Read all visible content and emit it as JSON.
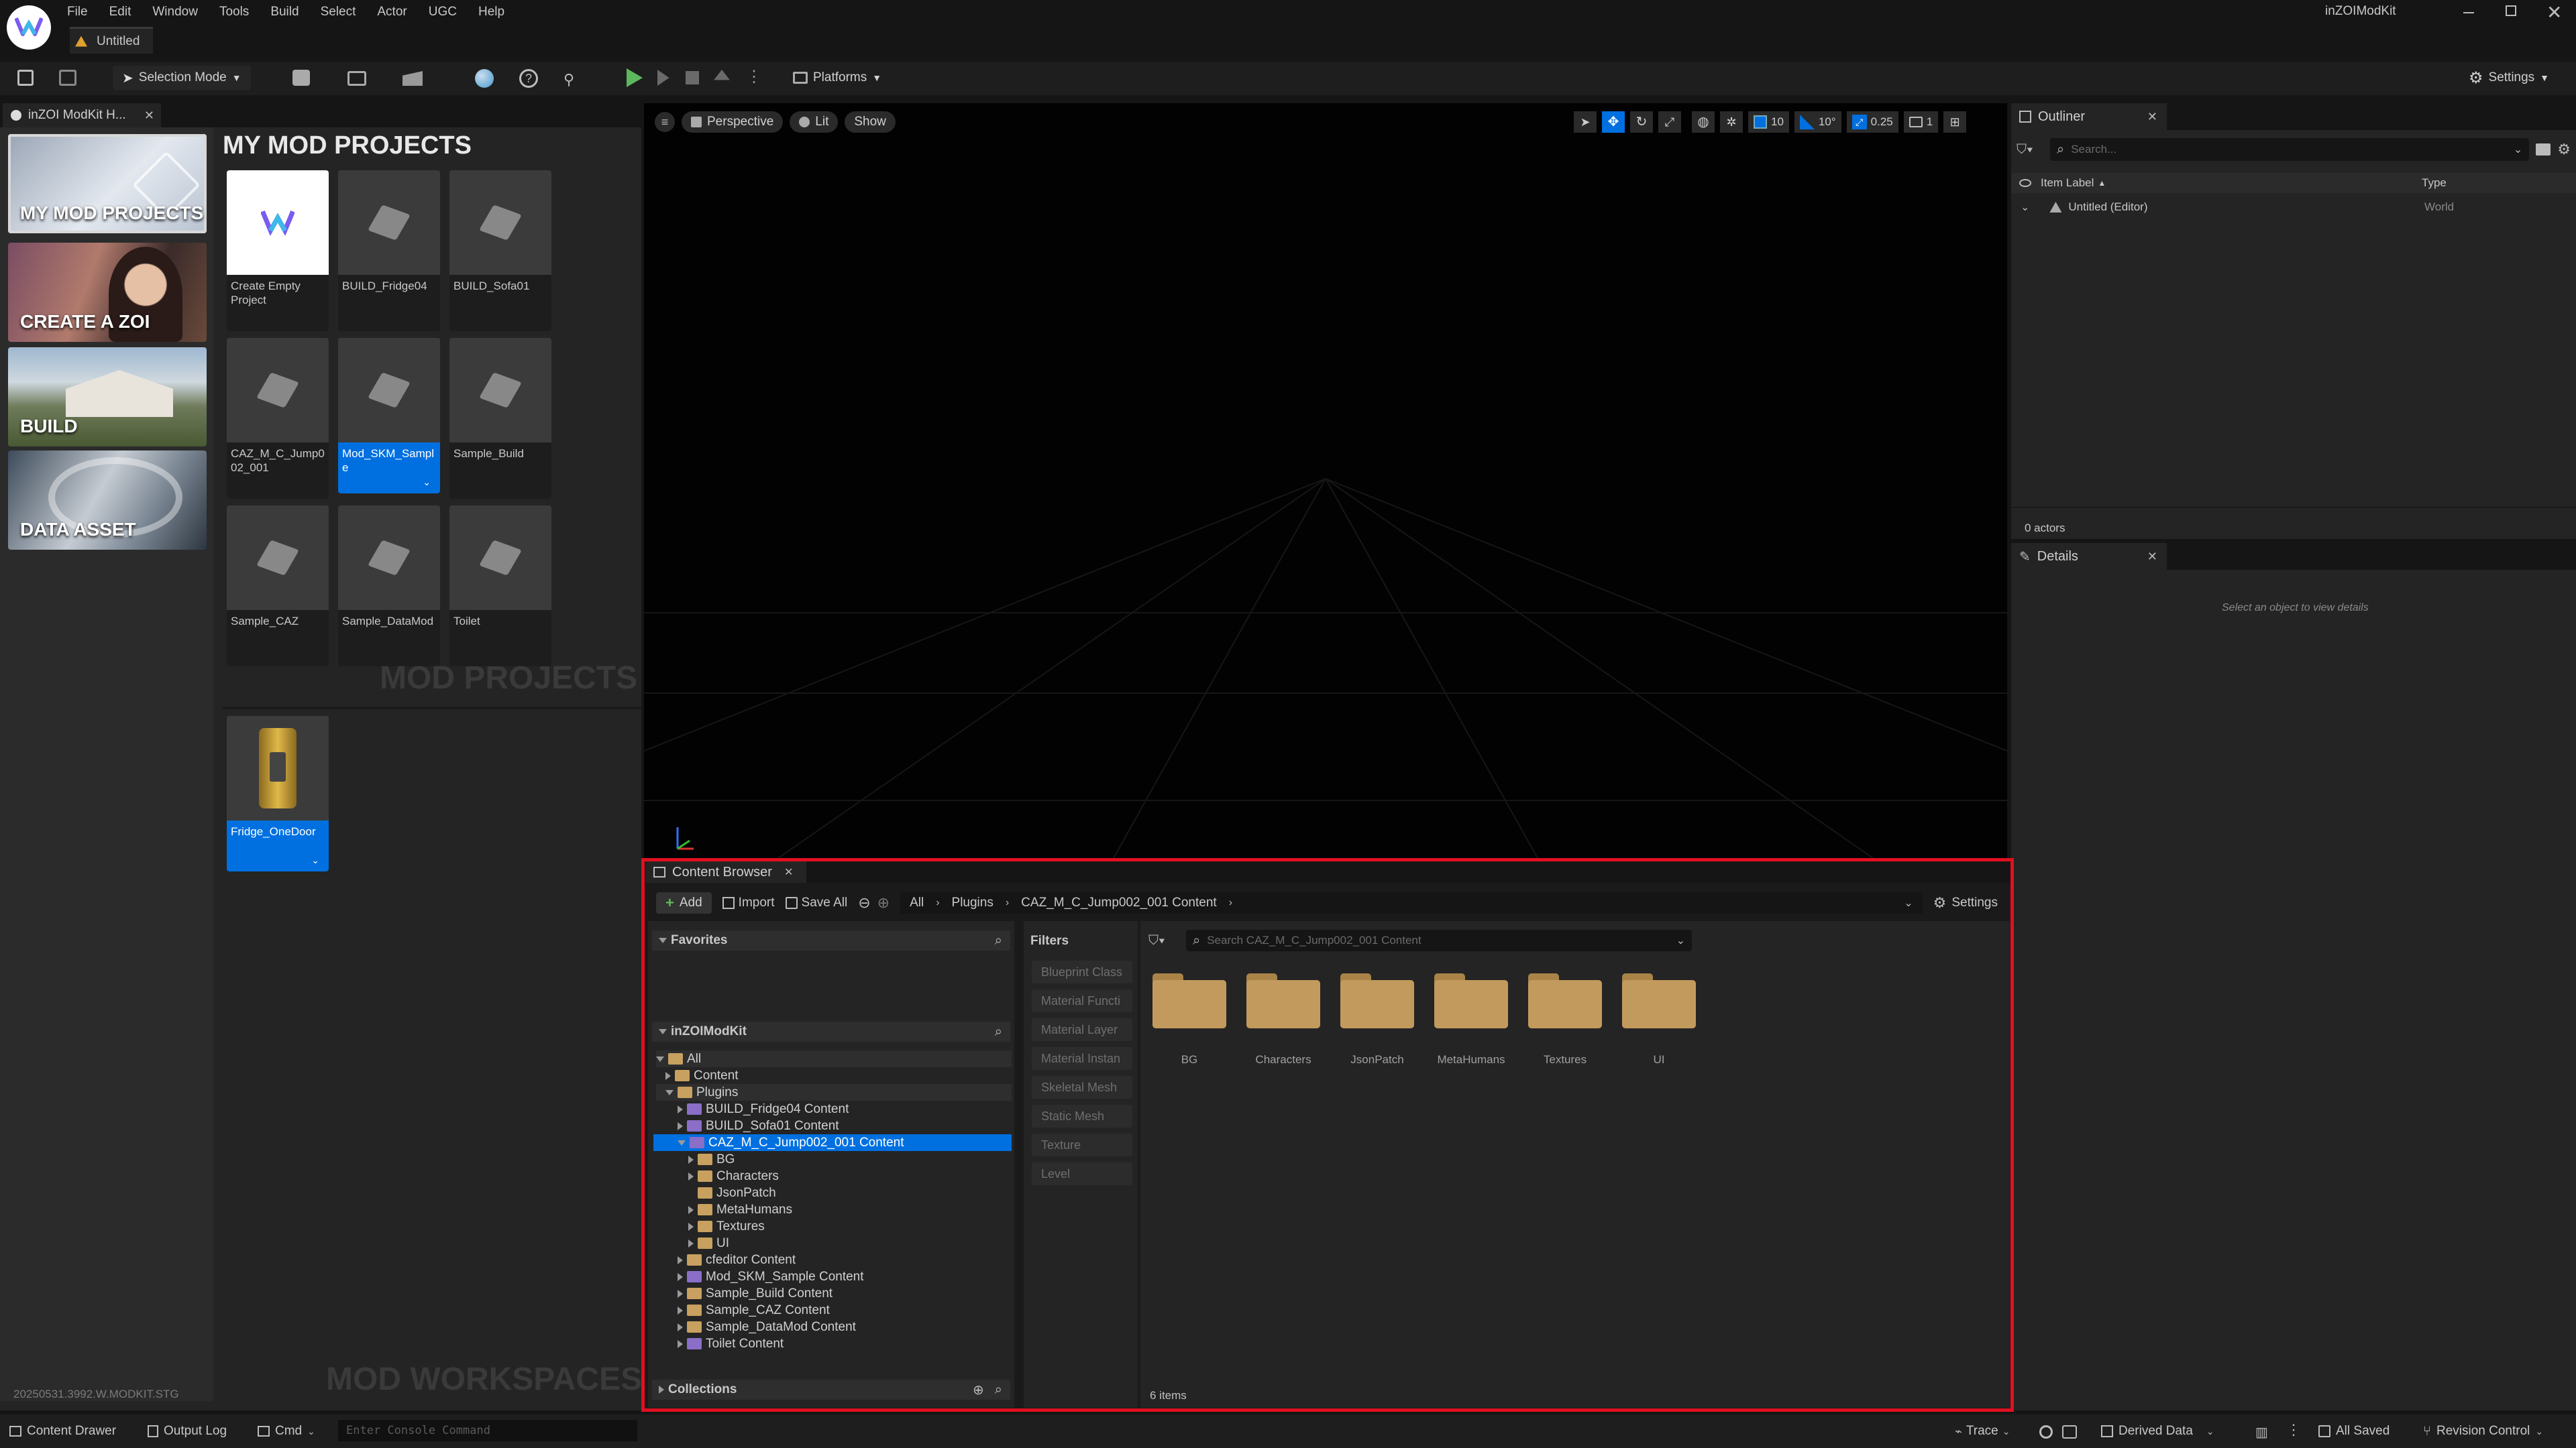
{
  "app": {
    "title": "inZOIModKit",
    "doc_tab": "Untitled",
    "menu": [
      "File",
      "Edit",
      "Window",
      "Tools",
      "Build",
      "Select",
      "Actor",
      "UGC",
      "Help"
    ]
  },
  "toolbar": {
    "selection_mode": "Selection Mode",
    "platforms": "Platforms",
    "settings": "Settings"
  },
  "hub": {
    "tab": "inZOI ModKit H...",
    "title": "MY MOD PROJECTS",
    "categories": [
      "MY MOD PROJECTS",
      "CREATE A ZOI",
      "BUILD",
      "DATA ASSET"
    ],
    "projects": [
      "Create Empty Project",
      "BUILD_Fridge04",
      "BUILD_Sofa01",
      "CAZ_M_C_Jump002_001",
      "Mod_SKM_Sample",
      "Sample_Build",
      "Sample_CAZ",
      "Sample_DataMod",
      "Toilet"
    ],
    "section_projects": "MOD PROJECTS",
    "workspaces": [
      "Fridge_OneDoor"
    ],
    "section_workspaces": "MOD WORKSPACES",
    "version": "20250531.3992.W.MODKIT.STG"
  },
  "viewport": {
    "perspective": "Perspective",
    "lit": "Lit",
    "show": "Show",
    "grid": "10",
    "angle": "10°",
    "scale": "0.25",
    "camera": "1"
  },
  "outliner": {
    "tab": "Outliner",
    "search_placeholder": "Search...",
    "col_label": "Item Label",
    "col_type": "Type",
    "row_label": "Untitled (Editor)",
    "row_type": "World",
    "count": "0 actors"
  },
  "details": {
    "tab": "Details",
    "empty": "Select an object to view details"
  },
  "content_browser": {
    "tab": "Content Browser",
    "add": "Add",
    "import": "Import",
    "save_all": "Save All",
    "path": [
      "All",
      "Plugins",
      "CAZ_M_C_Jump002_001 Content"
    ],
    "settings": "Settings",
    "favorites": "Favorites",
    "root": "inZOIModKit",
    "tree": [
      {
        "label": "All",
        "depth": 0,
        "open": true
      },
      {
        "label": "Content",
        "depth": 1,
        "open": false
      },
      {
        "label": "Plugins",
        "depth": 1,
        "open": true
      },
      {
        "label": "BUILD_Fridge04 Content",
        "depth": 2,
        "open": false,
        "plugin": true
      },
      {
        "label": "BUILD_Sofa01 Content",
        "depth": 2,
        "open": false,
        "plugin": true
      },
      {
        "label": "CAZ_M_C_Jump002_001 Content",
        "depth": 2,
        "open": true,
        "plugin": true,
        "selected": true
      },
      {
        "label": "BG",
        "depth": 3,
        "open": false
      },
      {
        "label": "Characters",
        "depth": 3,
        "open": false
      },
      {
        "label": "JsonPatch",
        "depth": 3,
        "open": false
      },
      {
        "label": "MetaHumans",
        "depth": 3,
        "open": false
      },
      {
        "label": "Textures",
        "depth": 3,
        "open": false
      },
      {
        "label": "UI",
        "depth": 3,
        "open": false
      },
      {
        "label": "cfeditor Content",
        "depth": 2,
        "open": false,
        "plugin": true
      },
      {
        "label": "Mod_SKM_Sample Content",
        "depth": 2,
        "open": false,
        "plugin": true
      },
      {
        "label": "Sample_Build Content",
        "depth": 2,
        "open": false,
        "plugin": true
      },
      {
        "label": "Sample_CAZ Content",
        "depth": 2,
        "open": false,
        "plugin": true
      },
      {
        "label": "Sample_DataMod Content",
        "depth": 2,
        "open": false,
        "plugin": true
      },
      {
        "label": "Toilet Content",
        "depth": 2,
        "open": false,
        "plugin": true
      }
    ],
    "collections": "Collections",
    "filters_label": "Filters",
    "filters": [
      "Blueprint Class",
      "Material Functi",
      "Material Layer",
      "Material Instan",
      "Skeletal Mesh",
      "Static Mesh",
      "Texture",
      "Level"
    ],
    "search_placeholder": "Search CAZ_M_C_Jump002_001 Content",
    "folders": [
      "BG",
      "Characters",
      "JsonPatch",
      "MetaHumans",
      "Textures",
      "UI"
    ],
    "item_count": "6 items"
  },
  "statusbar": {
    "content_drawer": "Content Drawer",
    "output_log": "Output Log",
    "cmd": "Cmd",
    "console_placeholder": "Enter Console Command",
    "trace": "Trace",
    "derived_data": "Derived Data",
    "all_saved": "All Saved",
    "revision_control": "Revision Control"
  },
  "colors": {
    "accent": "#0070e0",
    "highlight": "#e01020",
    "folder": "#c39a5e",
    "play": "#5cb85c"
  }
}
